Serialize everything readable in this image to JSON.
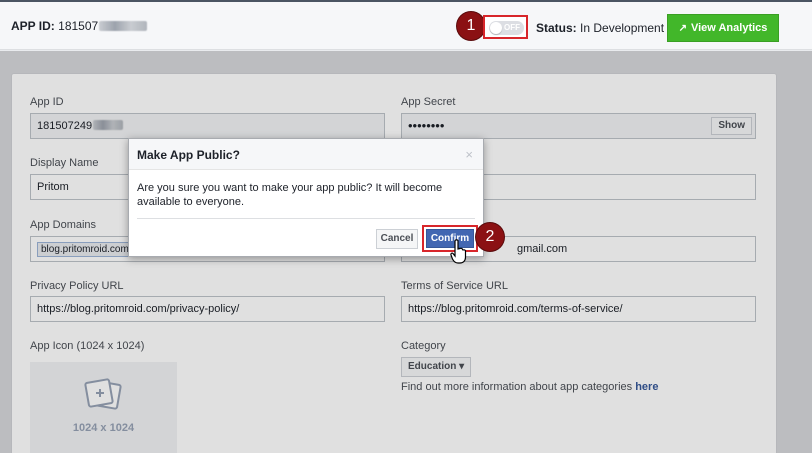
{
  "header": {
    "app_id_label": "APP ID:",
    "app_id_value": "181507",
    "toggle_text": "OFF",
    "status_label": "Status:",
    "status_value": "In Development",
    "analytics_label": "View Analytics"
  },
  "annotations": {
    "step1": "1",
    "step2": "2"
  },
  "form": {
    "app_id_label": "App ID",
    "app_id_value": "181507249",
    "app_secret_label": "App Secret",
    "app_secret_value": "••••••••",
    "show_label": "Show",
    "display_name_label": "Display Name",
    "display_name_value": "Pritom",
    "app_domains_label": "App Domains",
    "app_domain_chip": "blog.pritomroid.com",
    "contact_email_partial": "gmail.com",
    "privacy_label": "Privacy Policy URL",
    "privacy_value": "https://blog.pritomroid.com/privacy-policy/",
    "tos_label": "Terms of Service URL",
    "tos_value": "https://blog.pritomroid.com/terms-of-service/",
    "icon_label": "App Icon (1024 x 1024)",
    "icon_placeholder": "1024 x 1024",
    "category_label": "Category",
    "category_value": "Education",
    "category_info": "Find out more information about app categories",
    "category_link": "here"
  },
  "modal": {
    "title": "Make App Public?",
    "close": "×",
    "body": "Are you sure you want to make your app public? It will become available to everyone.",
    "cancel_label": "Cancel",
    "confirm_label": "Confirm"
  },
  "colors": {
    "confirm": "#4267b2",
    "analytics": "#42b72a",
    "annotation_badge": "#8b1113",
    "annotation_border": "#d8262b"
  }
}
